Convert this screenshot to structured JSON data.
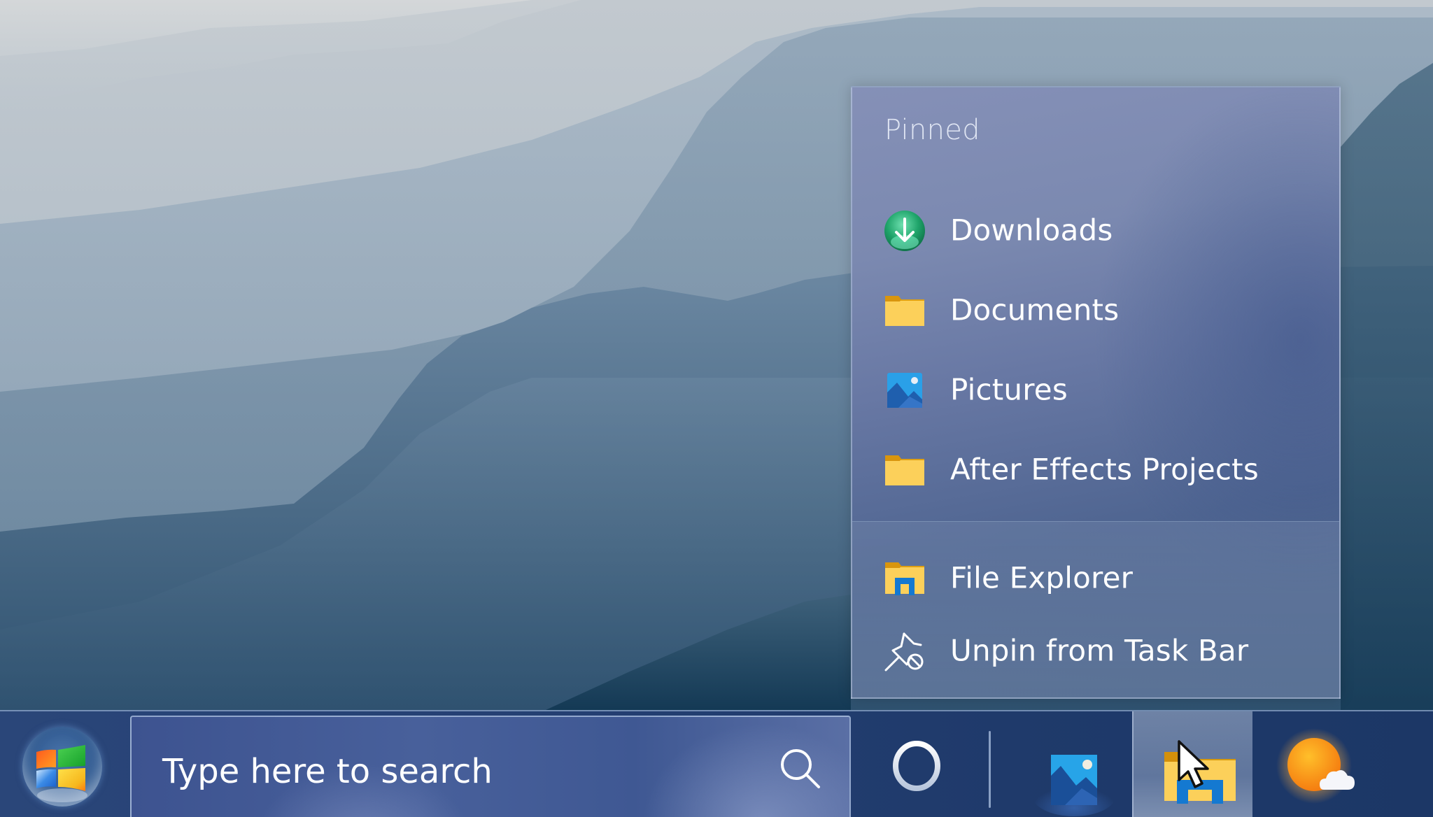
{
  "desktop": {
    "wallpaper": "misty-mountain-ridges"
  },
  "jump_list": {
    "header": "Pinned",
    "pinned_items": [
      {
        "label": "Downloads",
        "icon": "download-icon"
      },
      {
        "label": "Documents",
        "icon": "folder-icon"
      },
      {
        "label": "Pictures",
        "icon": "pictures-icon"
      },
      {
        "label": "After Effects Projects",
        "icon": "folder-icon"
      }
    ],
    "actions": [
      {
        "label": "File Explorer",
        "icon": "file-explorer-icon"
      },
      {
        "label": "Unpin from Task Bar",
        "icon": "unpin-icon"
      }
    ]
  },
  "taskbar": {
    "start_button": {
      "icon": "windows-logo-icon"
    },
    "search": {
      "placeholder": "Type here to search",
      "icon": "search-icon"
    },
    "cortana": {
      "icon": "cortana-ring-icon"
    },
    "apps": [
      {
        "name": "Photos",
        "icon": "photos-icon",
        "hovered": false
      },
      {
        "name": "File Explorer",
        "icon": "file-explorer-icon",
        "hovered": true
      },
      {
        "name": "Weather",
        "icon": "weather-icon",
        "hovered": false
      }
    ]
  },
  "colors": {
    "taskbar_bg": "#243f72",
    "jumplist_bg": "#6878a4",
    "folder_yellow": "#fcd05a",
    "download_green": "#21a366",
    "photos_blue": "#2aa0e8",
    "weather_orange": "#f7941d"
  }
}
